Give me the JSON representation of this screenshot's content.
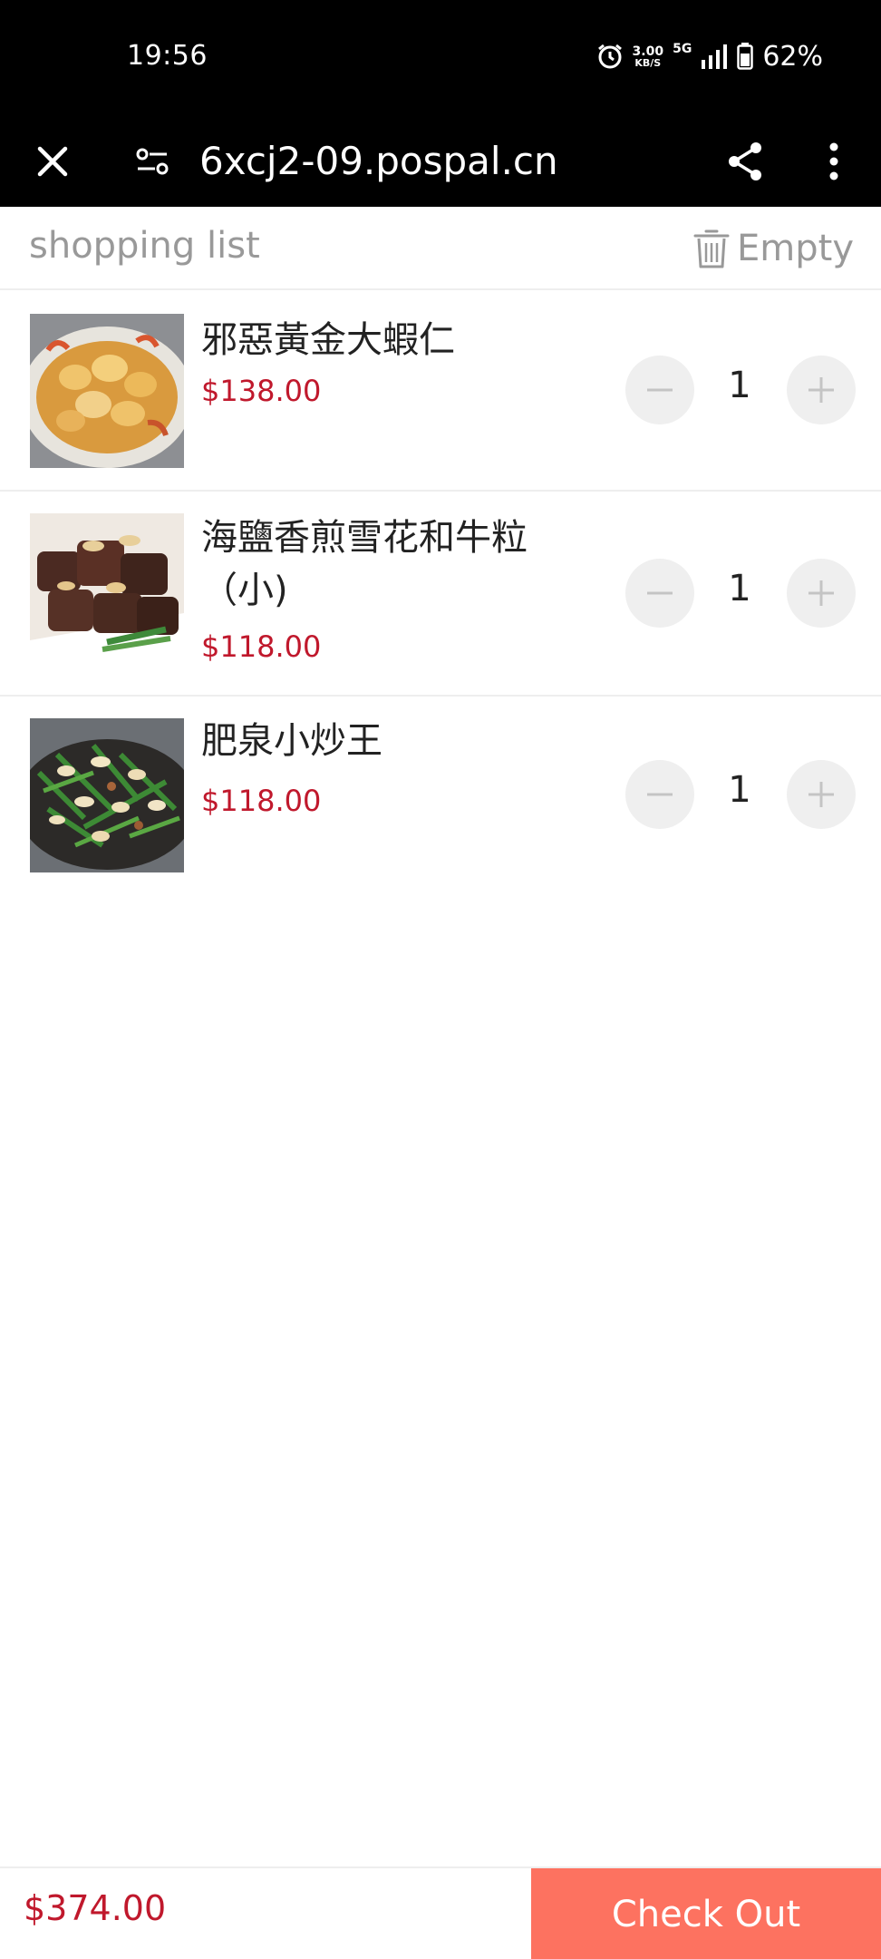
{
  "status_bar": {
    "time": "19:56",
    "net_speed": "3.00",
    "net_unit": "KB/S",
    "network": "5G",
    "battery": "62%"
  },
  "browser": {
    "url": "6xcj2-09.pospal.cn",
    "icons": [
      "close-icon",
      "tune-icon",
      "share-icon",
      "more-vert-icon"
    ]
  },
  "cart": {
    "title": "shopping list",
    "empty_label": "Empty",
    "items": [
      {
        "name": "邪惡黃金大蝦仁",
        "price": "$138.00",
        "qty": "1"
      },
      {
        "name": "海鹽香煎雪花和牛粒（小)",
        "price": "$118.00",
        "qty": "1"
      },
      {
        "name": "肥泉小炒王",
        "price": "$118.00",
        "qty": "1"
      }
    ]
  },
  "footer": {
    "total": "$374.00",
    "checkout_label": "Check Out"
  },
  "colors": {
    "price": "#c0182c",
    "checkout": "#fd7260",
    "muted": "#999999"
  }
}
